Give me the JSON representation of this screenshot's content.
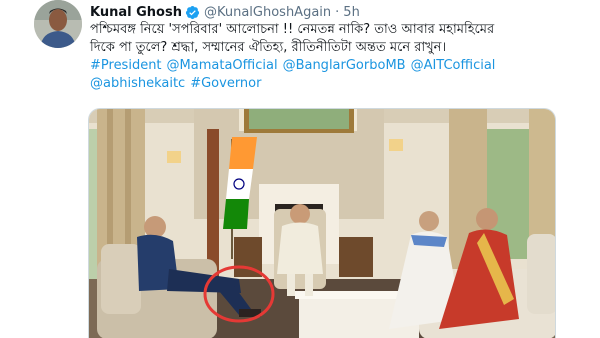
{
  "tweet": {
    "display_name": "Kunal Ghosh",
    "handle": "@KunalGhoshAgain",
    "separator": "·",
    "time": "5h",
    "text_line1": "পশ্চিমবঙ্গ নিয়ে 'সপরিবার' আলোচনা !! নেমতন্ন নাকি? তাও আবার মহামহিমের",
    "text_line2": "দিকে পা তুলে? শ্রদ্ধা, সম্মানের ঐতিহ্য, রীতিনীতিটা অন্তত মনে রাখুন।",
    "hashtags_line1": [
      "#President",
      "@MamataOfficial",
      "@BanglarGorboMB",
      "@AITCofficial"
    ],
    "hashtags_line2": [
      "@abhishekaitc",
      "#Governor"
    ]
  },
  "colors": {
    "link": "#1b95e0",
    "verified": "#1da1f2",
    "muted": "#5b7083",
    "annotation_circle": "#e53935"
  },
  "icons": {
    "verified": "verified-badge-icon"
  }
}
